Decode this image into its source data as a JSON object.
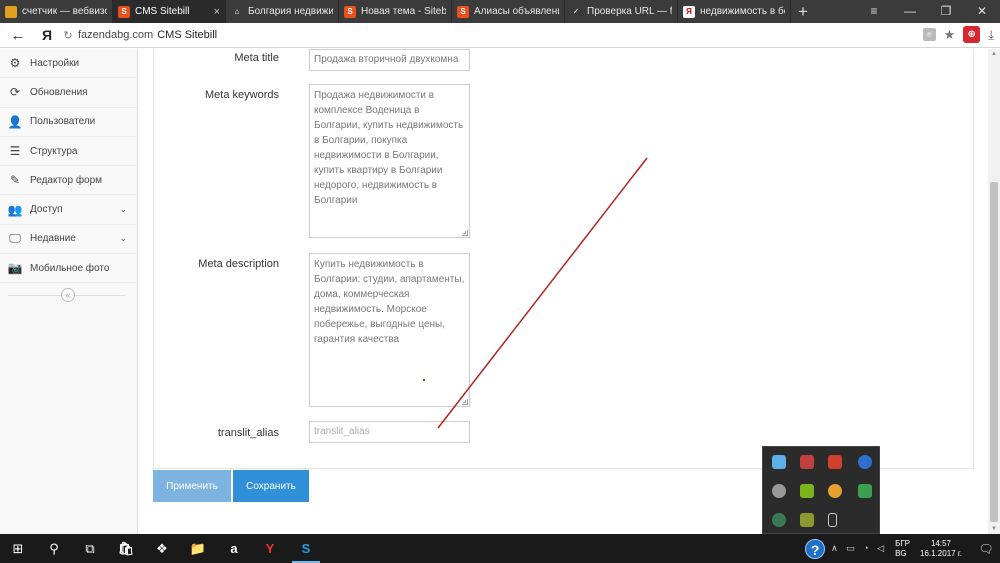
{
  "browser": {
    "tabs": [
      {
        "label": "счетчик — вебвизор",
        "icon_color": "#e0a020",
        "icon_text": "",
        "active": false
      },
      {
        "label": "CMS Sitebill",
        "icon_color": "#e8501e",
        "icon_text": "S",
        "active": true,
        "close": "×"
      },
      {
        "label": "Болгария недвижим",
        "icon_color": "#3b3b3b",
        "icon_text": "⌂",
        "active": false
      },
      {
        "label": "Новая тема - Sitebill",
        "icon_color": "#e8501e",
        "icon_text": "S",
        "active": false
      },
      {
        "label": "Алиасы объявлений",
        "icon_color": "#e8501e",
        "icon_text": "S",
        "active": false
      },
      {
        "label": "Проверка URL — fa",
        "icon_color": "#3b3b3b",
        "icon_text": "✓",
        "active": false
      },
      {
        "label": "недвижимость в бо",
        "icon_color": "#ffffff",
        "icon_text": "Я",
        "active": false
      }
    ],
    "new_tab": "+",
    "window_controls": {
      "menu": "≡",
      "minimize": "—",
      "restore": "❐",
      "close": "✕"
    },
    "address": {
      "back": "←",
      "ya": "Я",
      "reload": "↻",
      "domain": "fazendabg.com",
      "page_title": "CMS Sitebill"
    }
  },
  "sidebar": {
    "items": [
      {
        "label": "Настройки",
        "icon": "gear-icon",
        "glyph": "⚙",
        "chevron": false
      },
      {
        "label": "Обновления",
        "icon": "refresh-icon",
        "glyph": "⟳",
        "chevron": false
      },
      {
        "label": "Пользователи",
        "icon": "user-icon",
        "glyph": "👤",
        "chevron": false
      },
      {
        "label": "Структура",
        "icon": "list-icon",
        "glyph": "☰",
        "chevron": false
      },
      {
        "label": "Редактор форм",
        "icon": "edit-icon",
        "glyph": "✎",
        "chevron": false
      },
      {
        "label": "Доступ",
        "icon": "users-icon",
        "glyph": "👥",
        "chevron": true
      },
      {
        "label": "Недавние",
        "icon": "desktop-icon",
        "glyph": "🖵",
        "chevron": true
      },
      {
        "label": "Мобильное фото",
        "icon": "camera-icon",
        "glyph": "📷",
        "chevron": false
      }
    ],
    "collapse_glyph": "«"
  },
  "form": {
    "meta_title": {
      "label": "Meta title",
      "value": "Продажа  вторичной двухкомна"
    },
    "meta_keywords": {
      "label": "Meta keywords",
      "value": "Продажа недвижимости в комплексе Воденица в Болгарии, купить недвижимость в Болгарии, покупка недвижимости в Болгарии, купить квартиру в Болгарии недорого, недвижимость в Болгарии"
    },
    "meta_description": {
      "label": "Meta description",
      "value": "Купить недвижимость в Болгарии: студии, апартаменты, дома, коммерческая недвижимость. Морское побережье, выгодные цены, гарантия качества"
    },
    "translit_alias": {
      "label": "translit_alias",
      "placeholder": "translit_alias"
    }
  },
  "buttons": {
    "apply": "Применить",
    "save": "Сохранить"
  },
  "taskbar": {
    "start": "⊞",
    "search": "⚲",
    "task_view": "⧉",
    "apps": [
      {
        "name": "store-icon",
        "glyph": "🛍"
      },
      {
        "name": "dropbox-icon",
        "glyph": "❖"
      },
      {
        "name": "explorer-icon",
        "glyph": "📁"
      },
      {
        "name": "amazon-icon",
        "glyph": "a"
      },
      {
        "name": "yandex-browser-icon",
        "glyph": "Y"
      },
      {
        "name": "skype-icon",
        "glyph": "S"
      }
    ],
    "help": "?",
    "lang_top": "БГР",
    "lang_bottom": "BG",
    "time": "14:57",
    "date": "16.1.2017 г.",
    "notifications": "🗨"
  },
  "colors": {
    "apply_button": "#7cb3e0",
    "save_button": "#2f8fd7",
    "annotation_line": "#b22222"
  }
}
